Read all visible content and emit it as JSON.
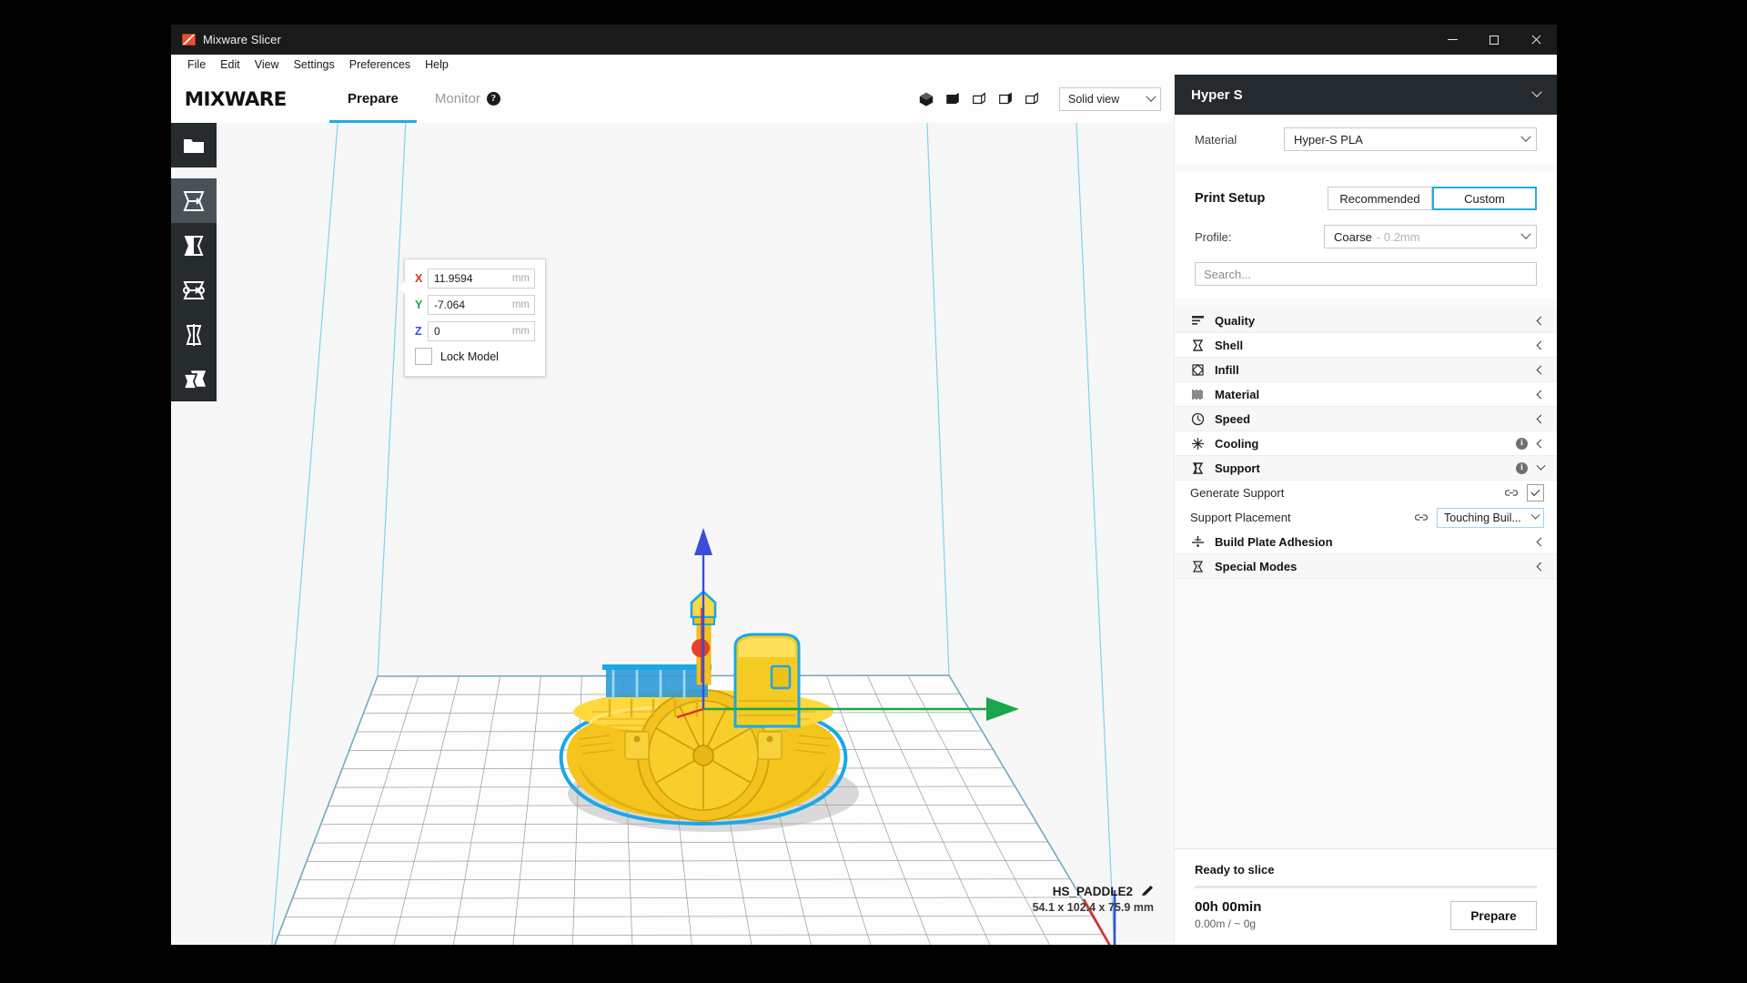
{
  "window": {
    "title": "Mixware Slicer",
    "icon": "app-logo-icon",
    "controls": {
      "minimize": "minimize",
      "maximize": "maximize",
      "close": "close"
    }
  },
  "menu": {
    "items": [
      "File",
      "Edit",
      "View",
      "Settings",
      "Preferences",
      "Help"
    ]
  },
  "app_bar": {
    "brand": "MIXWARE",
    "tabs": [
      {
        "label": "Prepare",
        "active": true
      },
      {
        "label": "Monitor",
        "active": false,
        "help": "?"
      }
    ],
    "view_mode": {
      "value": "Solid view"
    },
    "camera_views": [
      "view-3d-icon",
      "view-front-icon",
      "view-top-icon",
      "view-left-icon",
      "view-right-icon"
    ]
  },
  "tool_rail": {
    "items": [
      {
        "name": "open-file",
        "selected": false
      },
      {
        "name": "move-tool",
        "selected": true
      },
      {
        "name": "scale-tool",
        "selected": false
      },
      {
        "name": "rotate-tool",
        "selected": false
      },
      {
        "name": "mirror-tool",
        "selected": false
      },
      {
        "name": "per-model-settings-tool",
        "selected": false
      }
    ]
  },
  "position_panel": {
    "axes": [
      {
        "axis": "X",
        "value": "11.9594",
        "unit": "mm"
      },
      {
        "axis": "Y",
        "value": "-7.064",
        "unit": "mm"
      },
      {
        "axis": "Z",
        "value": "0",
        "unit": "mm"
      }
    ],
    "lock_label": "Lock Model",
    "lock_checked": false
  },
  "model": {
    "name": "HS_PADDLE2",
    "dimensions": "54.1 x 102.4 x 75.9 mm",
    "edit_icon": "pencil-icon"
  },
  "right_panel": {
    "printer": {
      "name": "Hyper S"
    },
    "material": {
      "label": "Material",
      "value": "Hyper-S PLA"
    },
    "print_setup": {
      "title": "Print Setup",
      "modes": [
        {
          "label": "Recommended",
          "active": false
        },
        {
          "label": "Custom",
          "active": true
        }
      ],
      "profile_label": "Profile:",
      "profile_name": "Coarse",
      "profile_layer": "- 0.2mm",
      "search_placeholder": "Search..."
    },
    "categories": [
      {
        "label": "Quality",
        "icon": "quality-icon",
        "expanded": false,
        "info": false
      },
      {
        "label": "Shell",
        "icon": "shell-icon",
        "expanded": false,
        "info": false
      },
      {
        "label": "Infill",
        "icon": "infill-icon",
        "expanded": false,
        "info": false
      },
      {
        "label": "Material",
        "icon": "material-icon",
        "expanded": false,
        "info": false
      },
      {
        "label": "Speed",
        "icon": "speed-icon",
        "expanded": false,
        "info": false
      },
      {
        "label": "Cooling",
        "icon": "cooling-icon",
        "expanded": false,
        "info": true
      },
      {
        "label": "Support",
        "icon": "support-icon",
        "expanded": true,
        "info": true
      }
    ],
    "support_settings": [
      {
        "label": "Generate Support",
        "control": "checkbox",
        "checked": true
      },
      {
        "label": "Support Placement",
        "control": "select",
        "value": "Touching Buil..."
      }
    ],
    "categories_after": [
      {
        "label": "Build Plate Adhesion",
        "icon": "adhesion-icon",
        "expanded": false,
        "info": false
      },
      {
        "label": "Special Modes",
        "icon": "special-modes-icon",
        "expanded": false,
        "info": false
      }
    ],
    "slice": {
      "status": "Ready to slice",
      "time": "00h 00min",
      "material_usage": "0.00m / ~ 0g",
      "button": "Prepare"
    }
  },
  "colors": {
    "accent": "#26a9e0",
    "panel_dark": "#242a2e",
    "titlebar": "#1a1a1a",
    "rail": "#262b2e",
    "rail_selected": "#4a5257",
    "model_yellow": "#ffd83d",
    "model_outline": "#1aa7e8",
    "axis_x": "#d93025",
    "axis_y": "#1aa64b",
    "axis_z": "#3b4ddb"
  }
}
